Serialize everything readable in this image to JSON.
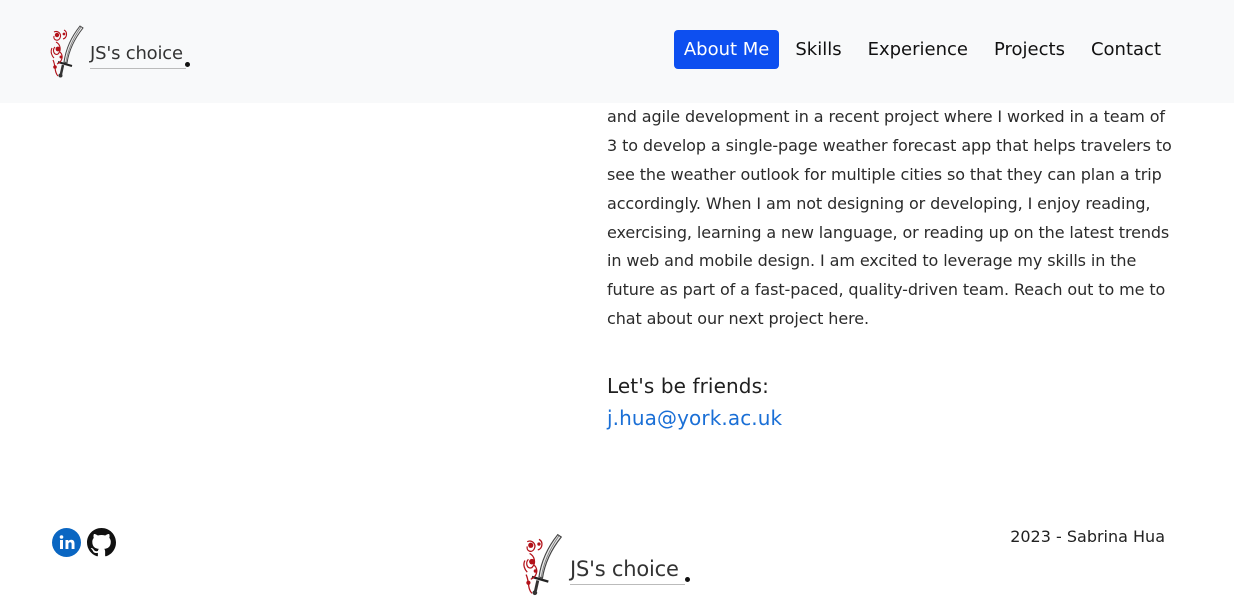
{
  "navbar": {
    "brand": {
      "text": "JS's choice",
      "logo_icon": "sword-flower-logo-icon"
    },
    "links": [
      {
        "label": "About Me",
        "active": true
      },
      {
        "label": "Skills",
        "active": false
      },
      {
        "label": "Experience",
        "active": false
      },
      {
        "label": "Projects",
        "active": false
      },
      {
        "label": "Contact",
        "active": false
      }
    ]
  },
  "about": {
    "paragraph": "engage users for an impactful user experience. I applied aspects of UX and agile development in a recent project where I worked in a team of 3 to develop a single-page weather forecast app that helps travelers to see the weather outlook for multiple cities so that they can plan a trip accordingly. When I am not designing or developing, I enjoy reading, exercising, learning a new language, or reading up on the latest trends in web and mobile design. I am excited to leverage my skills in the future as part of a fast-paced, quality-driven team. Reach out to me to chat about our next project here."
  },
  "friends": {
    "heading": "Let's be friends:",
    "email": "j.hua@york.ac.uk"
  },
  "footer": {
    "social": [
      {
        "name": "linkedin-icon",
        "color": "#0a66c2"
      },
      {
        "name": "github-icon",
        "color": "#111111"
      }
    ],
    "brand_text": "JS's choice",
    "copyright": "2023 - Sabrina Hua"
  },
  "colors": {
    "accent": "#0d4ff0",
    "link": "#1a6fd6",
    "navbar_bg": "#f8f9fa",
    "logo_red": "#b3121a"
  }
}
